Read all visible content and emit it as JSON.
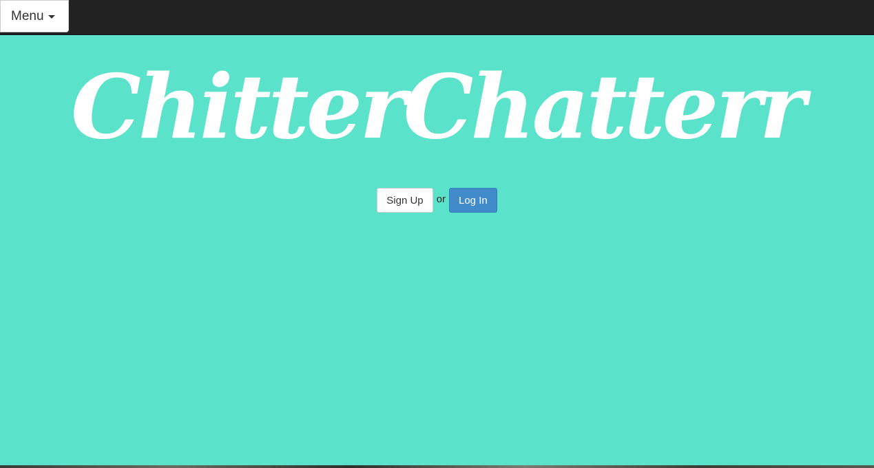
{
  "navbar": {
    "menu_label": "Menu",
    "menu_icon": "caret-down-icon",
    "background": "#222222"
  },
  "hero": {
    "brand_title": "ChitterChatterr",
    "background": "#5ae3ca",
    "signup_label": "Sign Up",
    "or_text": "or",
    "login_label": "Log In",
    "login_color": "#428bca"
  }
}
